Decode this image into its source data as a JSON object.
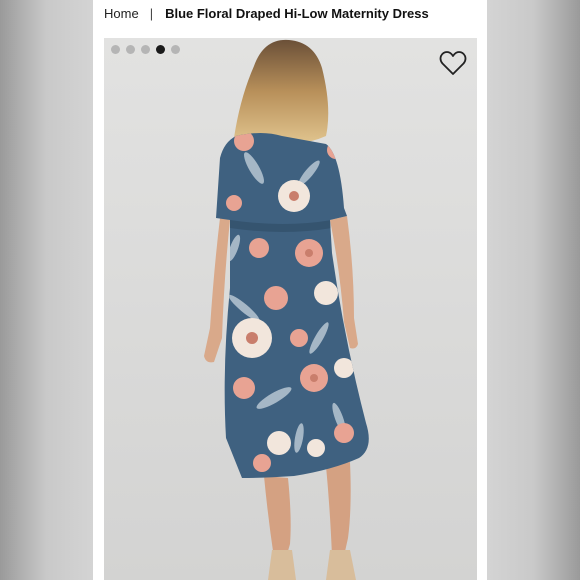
{
  "breadcrumb": {
    "home_label": "Home",
    "separator": "|",
    "current_label": "Blue Floral Draped Hi-Low Maternity Dress"
  },
  "gallery": {
    "image_count": 5,
    "active_index": 4,
    "favorite_icon": "heart-outline-icon",
    "colors": {
      "dress": "#3f6180",
      "flower_pink": "#e8a393",
      "flower_cream": "#f2e6dc",
      "leaf": "#b8c7d3"
    }
  }
}
